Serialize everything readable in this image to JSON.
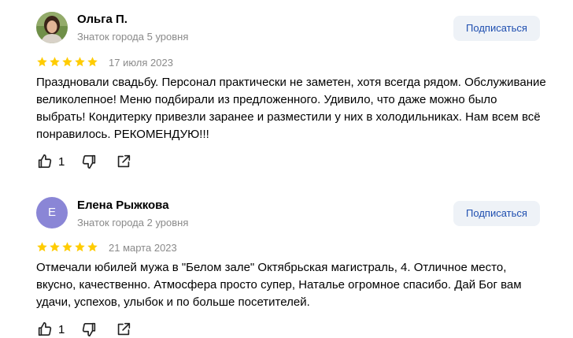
{
  "reviews": [
    {
      "name": "Ольга П.",
      "level": "Знаток города 5 уровня",
      "subscribe": "Подписаться",
      "rating": 5,
      "date": "17 июля 2023",
      "text": "Праздновали свадьбу. Персонал практически не заметен, хотя всегда рядом. Обслуживание великолепное! Меню подбирали из предложенного. Удивило, что даже можно было выбрать! Кондитерку привезли заранее и разместили у них в холодильниках. Нам всем всё понравилось. РЕКОМЕНДУЮ!!!",
      "likes": "1"
    },
    {
      "name": "Елена Рыжкова",
      "avatar_letter": "Е",
      "level": "Знаток города 2 уровня",
      "subscribe": "Подписаться",
      "rating": 5,
      "date": "21 марта 2023",
      "text": "Отмечали юбилей мужа в \"Белом зале\" Октябрьская магистраль, 4. Отличное место, вкусно, качественно. Атмосфера просто супер, Наталье огромное спасибо. Дай Бог вам удачи, успехов, улыбок и по больше посетителей.",
      "likes": "1"
    }
  ],
  "colors": {
    "star": "#fc0",
    "subscribe_bg": "#eef2f7",
    "subscribe_text": "#1f4fb0",
    "avatar_letter_bg": "#8a86d6"
  },
  "icons": [
    "thumbs-up-icon",
    "thumbs-down-icon",
    "share-icon",
    "star-icon"
  ]
}
